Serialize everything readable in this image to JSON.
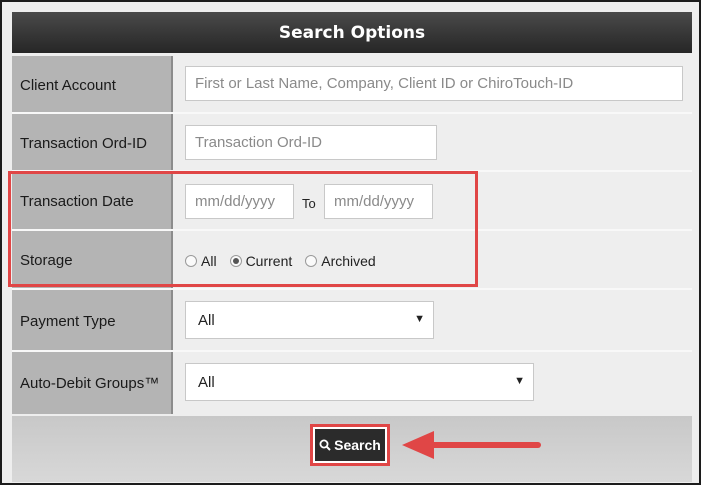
{
  "header": {
    "title": "Search Options"
  },
  "fields": {
    "client_account": {
      "label": "Client Account",
      "placeholder": "First or Last Name, Company, Client ID or ChiroTouch-ID"
    },
    "transaction_ord_id": {
      "label": "Transaction Ord-ID",
      "placeholder": "Transaction Ord-ID"
    },
    "transaction_date": {
      "label": "Transaction Date",
      "from_placeholder": "mm/dd/yyyy",
      "to_label": "To",
      "to_placeholder": "mm/dd/yyyy"
    },
    "storage": {
      "label": "Storage",
      "options": [
        {
          "label": "All",
          "checked": false
        },
        {
          "label": "Current",
          "checked": true
        },
        {
          "label": "Archived",
          "checked": false
        }
      ]
    },
    "payment_type": {
      "label": "Payment Type",
      "selected": "All"
    },
    "auto_debit_groups": {
      "label": "Auto-Debit Groups™",
      "selected": "All"
    }
  },
  "footer": {
    "search_label": "Search"
  },
  "colors": {
    "highlight": "#e04646",
    "header": "#333333",
    "label_bg": "#b4b4b4"
  }
}
